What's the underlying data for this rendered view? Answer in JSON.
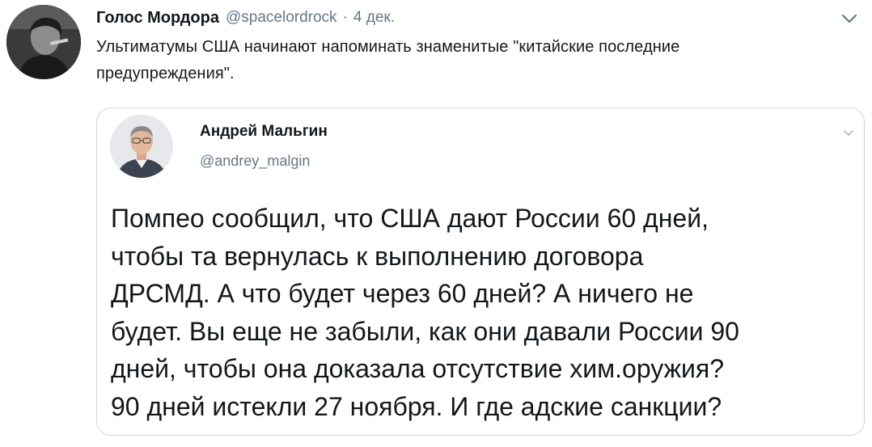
{
  "tweet": {
    "display_name": "Голос Мордора",
    "handle": "@spacelordrock",
    "separator": "·",
    "timestamp": "4 дек.",
    "text_lines": [
      "Ультиматумы США начинают напоминать знаменитые \"китайские последние",
      "предупреждения\"."
    ],
    "avatar_icon": "user-avatar-photo",
    "menu_icon": "chevron-down-icon"
  },
  "quote": {
    "display_name": "Андрей Мальгин",
    "handle": "@andrey_malgin",
    "avatar_icon": "user-avatar-photo",
    "menu_icon": "chevron-down-icon",
    "text_lines": [
      "Помпео сообщил, что США дают России 60 дней,",
      "чтобы та вернулась к выполнению договора",
      "ДРСМД. А что будет через 60 дней? А ничего не",
      "будет. Вы еще не забыли, как они давали России 90",
      "дней, чтобы она доказала отсутствие хим.оружия?",
      "90 дней истекли 27 ноября. И где адские санкции?"
    ]
  },
  "colors": {
    "primary_text": "#14171a",
    "secondary_text": "#657786",
    "border": "#ccd6dd"
  }
}
